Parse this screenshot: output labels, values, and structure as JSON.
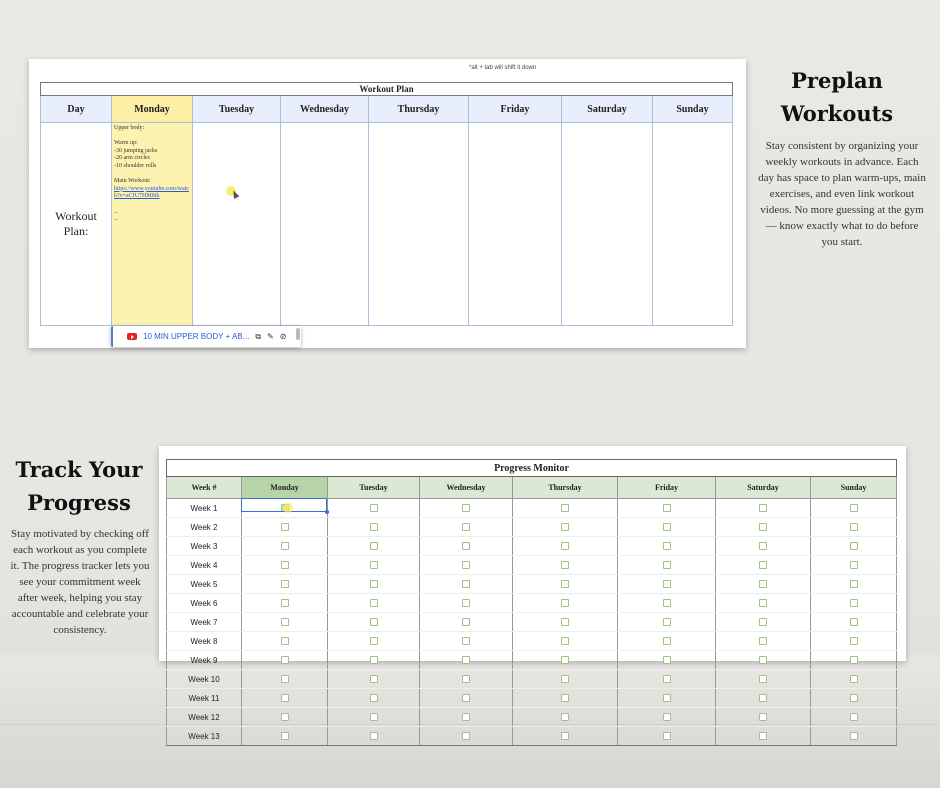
{
  "workout_plan": {
    "hint": "*alt + tab will shift it down",
    "title": "Workout Plan",
    "columns": [
      "Day",
      "Monday",
      "Tuesday",
      "Wednesday",
      "Thursday",
      "Friday",
      "Saturday",
      "Sunday"
    ],
    "row_label_line1": "Workout",
    "row_label_line2": "Plan:",
    "monday_lines": [
      "Upper body:",
      "",
      "Warm up:",
      "-30 jumping jacks",
      "-20 arm circles",
      "-10 shoulder rolls",
      "",
      "Main Workout:"
    ],
    "monday_link": "https://www.youtube.com/watch?v=aCIU7HM8ik",
    "monday_after": [
      "...",
      "..."
    ],
    "chip_label": "10 MIN UPPER BODY + AB...",
    "colors": {
      "header_bg": "#e8eefb",
      "monday_bg": "#fdf2b0",
      "border": "#a9bfd9"
    }
  },
  "preplan": {
    "heading_line1": "Preplan",
    "heading_line2": "Workouts",
    "body": "Stay consistent by organizing your weekly workouts in advance. Each day has space to plan warm-ups, main exercises, and even link workout videos. No more guessing at the gym — know exactly what to do before you start."
  },
  "track": {
    "heading_line1": "Track Your",
    "heading_line2": "Progress",
    "body": "Stay motivated by checking off each workout as you complete it. The progress tracker lets you see your commitment week after week, helping you stay accountable and celebrate your consistency."
  },
  "progress_monitor": {
    "title": "Progress Monitor",
    "columns": [
      "Week #",
      "Monday",
      "Tuesday",
      "Wednesday",
      "Thursday",
      "Friday",
      "Saturday",
      "Sunday"
    ],
    "weeks": [
      "Week 1",
      "Week 2",
      "Week 3",
      "Week 4",
      "Week 5",
      "Week 6",
      "Week 7",
      "Week 8",
      "Week 9",
      "Week 10",
      "Week 11",
      "Week 12",
      "Week 13"
    ],
    "checked": [
      [
        0,
        1
      ]
    ],
    "colors": {
      "header_bg": "#dbe8d3",
      "monday_header_bg": "#b7d3a8",
      "checkbox_border": "#9cc487"
    }
  }
}
